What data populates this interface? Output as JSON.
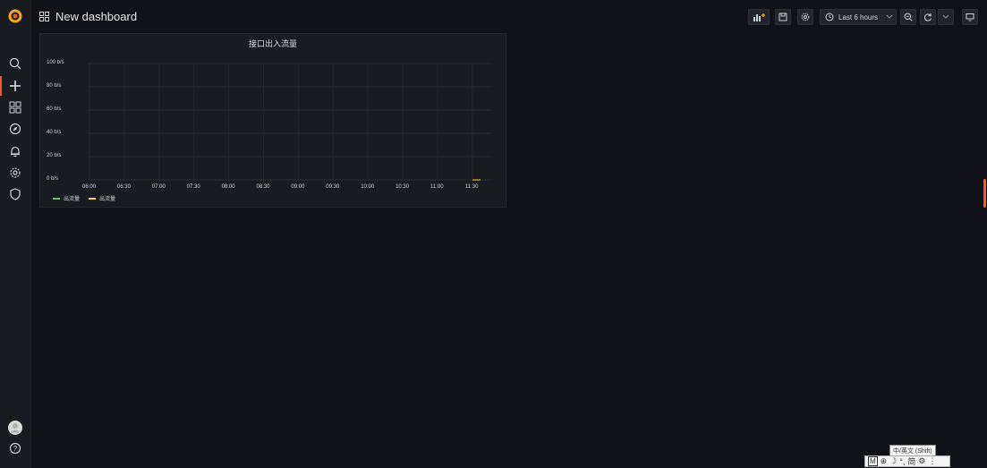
{
  "app": {
    "accent_color": "#f05a28",
    "logo_icon": "grafana-logo-icon"
  },
  "sidebar": {
    "items": [
      {
        "icon": "search-icon"
      },
      {
        "icon": "plus-icon"
      },
      {
        "icon": "dashboards-icon"
      },
      {
        "icon": "explore-icon"
      },
      {
        "icon": "alerting-bell-icon"
      },
      {
        "icon": "gear-icon"
      },
      {
        "icon": "shield-icon"
      }
    ],
    "bottom": [
      {
        "icon": "avatar"
      },
      {
        "icon": "help-icon"
      }
    ]
  },
  "header": {
    "title": "New dashboard",
    "time_range": "Last 6 hours"
  },
  "panel": {
    "title": "接口出入流量",
    "legend": [
      {
        "label": "出流量",
        "color": "#73bf69"
      },
      {
        "label": "出流量",
        "color": "#fade2a"
      }
    ]
  },
  "chart_data": {
    "type": "line",
    "title": "接口出入流量",
    "y_ticks": [
      "100 b/s",
      "80 b/s",
      "60 b/s",
      "40 b/s",
      "20 b/s",
      "0 b/s"
    ],
    "ylim": [
      0,
      100
    ],
    "x_ticks": [
      "06:00",
      "06:30",
      "07:00",
      "07:30",
      "08:00",
      "08:30",
      "09:00",
      "09:30",
      "10:00",
      "10:30",
      "11:00",
      "11:30"
    ],
    "series": [
      {
        "name": "出流量",
        "color": "#73bf69",
        "x": [],
        "values": []
      },
      {
        "name": "出流量",
        "color": "#fade2a",
        "x": [
          "11:30",
          "11:37"
        ],
        "values": [
          0,
          0
        ]
      }
    ],
    "grid": true,
    "legend_position": "bottom-left"
  },
  "ime": {
    "tooltip": "中/英文 (Shift)",
    "items": [
      "M",
      "⊕",
      "☽",
      "°,",
      "简",
      "⚙",
      "⋮"
    ]
  }
}
